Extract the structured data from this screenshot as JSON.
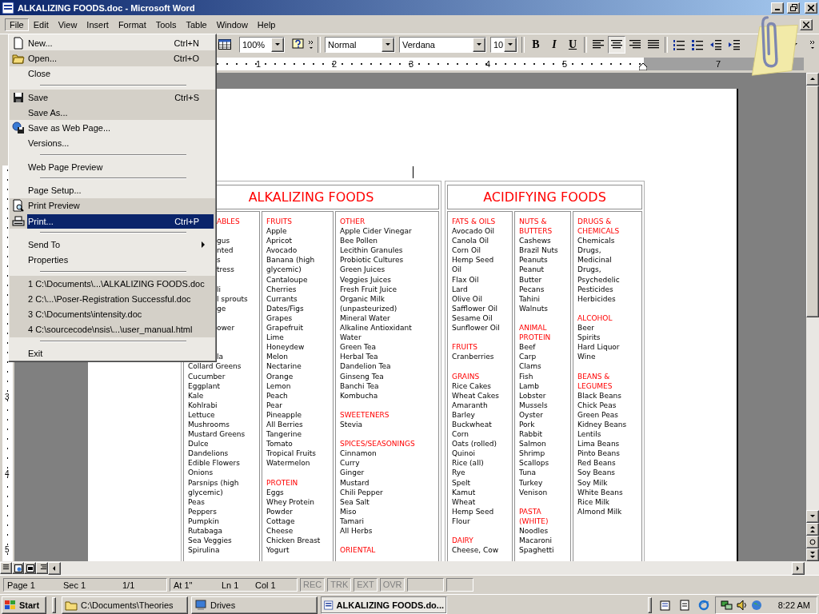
{
  "window": {
    "title": "ALKALIZING FOODS.doc - Microsoft Word"
  },
  "menu_bar": [
    {
      "label": "File",
      "selected": true
    },
    {
      "label": "Edit",
      "selected": false
    },
    {
      "label": "View",
      "selected": false
    },
    {
      "label": "Insert",
      "selected": false
    },
    {
      "label": "Format",
      "selected": false
    },
    {
      "label": "Tools",
      "selected": false
    },
    {
      "label": "Table",
      "selected": false
    },
    {
      "label": "Window",
      "selected": false
    },
    {
      "label": "Help",
      "selected": false
    }
  ],
  "toolbar": {
    "zoom": "100%",
    "style": "Normal",
    "font": "Verdana",
    "size": "10",
    "format_buttons": [
      {
        "label": "B",
        "selected": false
      },
      {
        "label": "I",
        "selected": false
      },
      {
        "label": "U",
        "selected": false
      }
    ],
    "align_buttons": [
      {
        "selected": false
      },
      {
        "selected": true
      },
      {
        "selected": false
      },
      {
        "selected": false
      }
    ]
  },
  "ruler": [
    "1",
    "2",
    "3",
    "4",
    "5",
    "7"
  ],
  "vertical_ruler": [
    "3",
    "4",
    "5"
  ],
  "file_menu": [
    {
      "kind": "command",
      "label": "New...",
      "shortcut": "Ctrl+N",
      "rarely_used": true,
      "selected": false,
      "submenu": false
    },
    {
      "kind": "command",
      "label": "Open...",
      "shortcut": "Ctrl+O",
      "rarely_used": false,
      "selected": false,
      "submenu": false
    },
    {
      "kind": "command",
      "label": "Close",
      "rarely_used": true,
      "selected": false,
      "submenu": false
    },
    {
      "kind": "separator"
    },
    {
      "kind": "command",
      "label": "Save",
      "shortcut": "Ctrl+S",
      "rarely_used": false,
      "selected": false,
      "submenu": false
    },
    {
      "kind": "command",
      "label": "Save As...",
      "rarely_used": false,
      "selected": false,
      "submenu": false
    },
    {
      "kind": "command",
      "label": "Save as Web Page...",
      "rarely_used": true,
      "selected": false,
      "submenu": false
    },
    {
      "kind": "command",
      "label": "Versions...",
      "rarely_used": true,
      "selected": false,
      "submenu": false
    },
    {
      "kind": "separator"
    },
    {
      "kind": "command",
      "label": "Web Page Preview",
      "rarely_used": true,
      "selected": false,
      "submenu": false
    },
    {
      "kind": "separator"
    },
    {
      "kind": "command",
      "label": "Page Setup...",
      "rarely_used": true,
      "selected": false,
      "submenu": false
    },
    {
      "kind": "command",
      "label": "Print Preview",
      "rarely_used": false,
      "selected": false,
      "submenu": false
    },
    {
      "kind": "command",
      "label": "Print...",
      "shortcut": "Ctrl+P",
      "rarely_used": false,
      "selected": true,
      "submenu": false
    },
    {
      "kind": "separator"
    },
    {
      "kind": "command",
      "label": "Send To",
      "rarely_used": true,
      "selected": false,
      "submenu": true
    },
    {
      "kind": "command",
      "label": "Properties",
      "rarely_used": true,
      "selected": false,
      "submenu": false
    },
    {
      "kind": "separator"
    },
    {
      "kind": "command",
      "label": "1 C:\\Documents\\...\\ALKALIZING FOODS.doc",
      "rarely_used": false,
      "selected": false,
      "submenu": false
    },
    {
      "kind": "command",
      "label": "2 C:\\...\\Poser-Registration Successful.doc",
      "rarely_used": false,
      "selected": false,
      "submenu": false
    },
    {
      "kind": "command",
      "label": "3 C:\\Documents\\intensity.doc",
      "rarely_used": false,
      "selected": false,
      "submenu": false
    },
    {
      "kind": "command",
      "label": "4 C:\\sourcecode\\nsis\\...\\user_manual.html",
      "rarely_used": false,
      "selected": false,
      "submenu": false
    },
    {
      "kind": "separator"
    },
    {
      "kind": "command",
      "label": "Exit",
      "rarely_used": true,
      "selected": false,
      "submenu": false
    }
  ],
  "tables": [
    {
      "title": "ALKALIZING FOODS",
      "columns": [
        [
          {
            "kind": "cut_heading",
            "text": "ABLES"
          },
          {
            "kind": "gap"
          },
          {
            "kind": "cut",
            "text": "gus"
          },
          {
            "kind": "cut",
            "text": "nted"
          },
          {
            "kind": "cut",
            "text": "s"
          },
          {
            "kind": "cut",
            "text": "tress"
          },
          {
            "kind": "gap"
          },
          {
            "kind": "cut",
            "text": "li"
          },
          {
            "kind": "cut",
            "text": "l sprouts"
          },
          {
            "kind": "cut",
            "text": "ge"
          },
          {
            "kind": "gap"
          },
          {
            "kind": "cut",
            "text": "ower"
          },
          {
            "kind": "gap"
          },
          {
            "kind": "gap"
          },
          {
            "kind": "cut",
            "text": "la"
          },
          "Collard Greens",
          "Cucumber",
          "Eggplant",
          "Kale",
          "Kohlrabi",
          "Lettuce",
          "Mushrooms",
          "Mustard Greens",
          "Dulce",
          "Dandelions",
          "Edible Flowers",
          "Onions",
          "Parsnips (high",
          "glycemic)",
          "Peas",
          "Peppers",
          "Pumpkin",
          "Rutabaga",
          "Sea Veggies",
          "Spirulina"
        ],
        [
          {
            "kind": "heading",
            "text": "FRUITS"
          },
          "Apple",
          "Apricot",
          "Avocado",
          "Banana (high",
          "glycemic)",
          "Cantaloupe",
          "Cherries",
          "Currants",
          "Dates/Figs",
          "Grapes",
          "Grapefruit",
          "Lime",
          "Honeydew",
          "Melon",
          "Nectarine",
          "Orange",
          "Lemon",
          "Peach",
          "Pear",
          "Pineapple",
          "All Berries",
          "Tangerine",
          "Tomato",
          "Tropical Fruits",
          "Watermelon",
          {
            "kind": "gap"
          },
          {
            "kind": "heading",
            "text": "PROTEIN"
          },
          "Eggs",
          "Whey Protein",
          "Powder",
          "Cottage",
          "Cheese",
          "Chicken Breast",
          "Yogurt"
        ],
        [
          {
            "kind": "heading",
            "text": "OTHER"
          },
          "Apple Cider Vinegar",
          "Bee Pollen",
          "Lecithin Granules",
          "Probiotic Cultures",
          "Green Juices",
          "Veggies Juices",
          "Fresh Fruit Juice",
          "Organic Milk",
          "(unpasteurized)",
          "Mineral Water",
          "Alkaline Antioxidant",
          "Water",
          "Green Tea",
          "Herbal Tea",
          "Dandelion Tea",
          "Ginseng Tea",
          "Banchi Tea",
          "Kombucha",
          {
            "kind": "gap"
          },
          {
            "kind": "heading",
            "text": "SWEETENERS"
          },
          "Stevia",
          {
            "kind": "gap"
          },
          {
            "kind": "heading",
            "text": "SPICES/SEASONINGS"
          },
          "Cinnamon",
          "Curry",
          "Ginger",
          "Mustard",
          "Chili Pepper",
          "Sea Salt",
          "Miso",
          "Tamari",
          "All Herbs",
          {
            "kind": "gap"
          },
          {
            "kind": "heading",
            "text": "ORIENTAL"
          }
        ]
      ]
    },
    {
      "title": "ACIDIFYING FOODS",
      "columns": [
        [
          {
            "kind": "heading",
            "text": "FATS & OILS"
          },
          "Avocado Oil",
          "Canola Oil",
          "Corn Oil",
          "Hemp Seed",
          "Oil",
          "Flax Oil",
          "Lard",
          "Olive Oil",
          "Safflower Oil",
          "Sesame Oil",
          "Sunflower Oil",
          {
            "kind": "gap"
          },
          {
            "kind": "heading",
            "text": "FRUITS"
          },
          "Cranberries",
          {
            "kind": "gap"
          },
          {
            "kind": "heading",
            "text": "GRAINS"
          },
          "Rice Cakes",
          "Wheat Cakes",
          "Amaranth",
          "Barley",
          "Buckwheat",
          "Corn",
          "Oats (rolled)",
          "Quinoi",
          "Rice (all)",
          "Rye",
          "Spelt",
          "Kamut",
          "Wheat",
          "Hemp Seed",
          "Flour",
          {
            "kind": "gap"
          },
          {
            "kind": "heading",
            "text": "DAIRY"
          },
          "Cheese, Cow"
        ],
        [
          {
            "kind": "heading",
            "text": "NUTS &"
          },
          {
            "kind": "heading",
            "text": "BUTTERS"
          },
          "Cashews",
          "Brazil Nuts",
          "Peanuts",
          "Peanut",
          "Butter",
          "Pecans",
          "Tahini",
          "Walnuts",
          {
            "kind": "gap"
          },
          {
            "kind": "heading",
            "text": "ANIMAL"
          },
          {
            "kind": "heading",
            "text": "PROTEIN"
          },
          "Beef",
          "Carp",
          "Clams",
          "Fish",
          "Lamb",
          "Lobster",
          "Mussels",
          "Oyster",
          "Pork",
          "Rabbit",
          "Salmon",
          "Shrimp",
          "Scallops",
          "Tuna",
          "Turkey",
          "Venison",
          {
            "kind": "gap"
          },
          {
            "kind": "heading",
            "text": "PASTA"
          },
          {
            "kind": "heading",
            "text": "(WHITE)"
          },
          "Noodles",
          "Macaroni",
          "Spaghetti"
        ],
        [
          {
            "kind": "heading",
            "text": "DRUGS &"
          },
          {
            "kind": "heading",
            "text": "CHEMICALS"
          },
          "Chemicals",
          "Drugs,",
          "Medicinal",
          "Drugs,",
          "Psychedelic",
          "Pesticides",
          "Herbicides",
          {
            "kind": "gap"
          },
          {
            "kind": "heading",
            "text": "ALCOHOL"
          },
          "Beer",
          "Spirits",
          "Hard Liquor",
          "Wine",
          {
            "kind": "gap"
          },
          {
            "kind": "heading",
            "text": "BEANS &"
          },
          {
            "kind": "heading",
            "text": "LEGUMES"
          },
          "Black Beans",
          "Chick Peas",
          "Green Peas",
          "Kidney Beans",
          "Lentils",
          "Lima Beans",
          "Pinto Beans",
          "Red Beans",
          "Soy Beans",
          "Soy Milk",
          "White Beans",
          "Rice Milk",
          "Almond Milk"
        ]
      ]
    }
  ],
  "status_bar": {
    "page": "Page 1",
    "section": "Sec 1",
    "pages": "1/1",
    "at": "At 1\"",
    "line": "Ln 1",
    "column": "Col 1",
    "modes": [
      {
        "label": "REC",
        "disabled": true
      },
      {
        "label": "TRK",
        "disabled": true
      },
      {
        "label": "EXT",
        "disabled": true
      },
      {
        "label": "OVR",
        "disabled": true
      }
    ]
  },
  "taskbar": {
    "start": "Start",
    "tasks": [
      {
        "label": "C:\\Documents\\Theories",
        "selected": false
      },
      {
        "label": "Drives",
        "selected": false
      },
      {
        "label": "ALKALIZING FOODS.do...",
        "selected": true
      }
    ],
    "clock": "8:22 AM"
  }
}
